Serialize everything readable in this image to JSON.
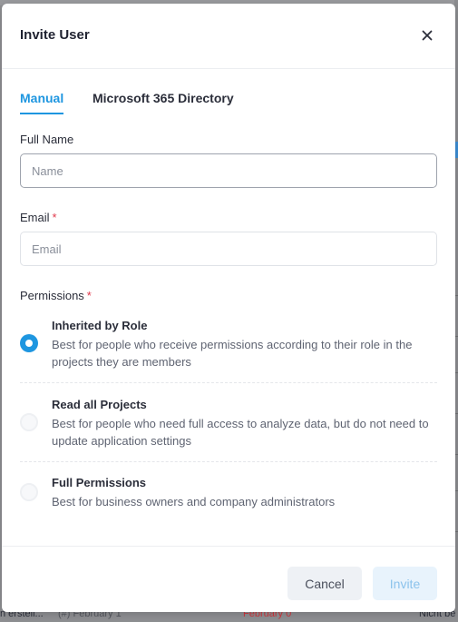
{
  "background": {
    "bottom_row": [
      "n erstell...",
      "(#) February 1",
      "February 0",
      "Nicht be"
    ]
  },
  "modal": {
    "title": "Invite User",
    "tabs": [
      {
        "label": "Manual",
        "active": true
      },
      {
        "label": "Microsoft 365 Directory",
        "active": false
      }
    ],
    "full_name": {
      "label": "Full Name",
      "placeholder": "Name",
      "value": ""
    },
    "email": {
      "label": "Email",
      "required_mark": "*",
      "placeholder": "Email",
      "value": ""
    },
    "permissions": {
      "label": "Permissions",
      "required_mark": "*",
      "options": [
        {
          "title": "Inherited by Role",
          "description": "Best for people who receive permissions according to their role in the projects they are members",
          "selected": true
        },
        {
          "title": "Read all Projects",
          "description": "Best for people who need full access to analyze data, but do not need to update application settings",
          "selected": false
        },
        {
          "title": "Full Permissions",
          "description": "Best for business owners and company administrators",
          "selected": false
        }
      ]
    },
    "footer": {
      "cancel_label": "Cancel",
      "invite_label": "Invite"
    }
  },
  "colors": {
    "accent": "#1e96e0",
    "required": "#e0384b",
    "overlay": "#8e8f92"
  },
  "icons": {
    "close": "close-icon"
  }
}
